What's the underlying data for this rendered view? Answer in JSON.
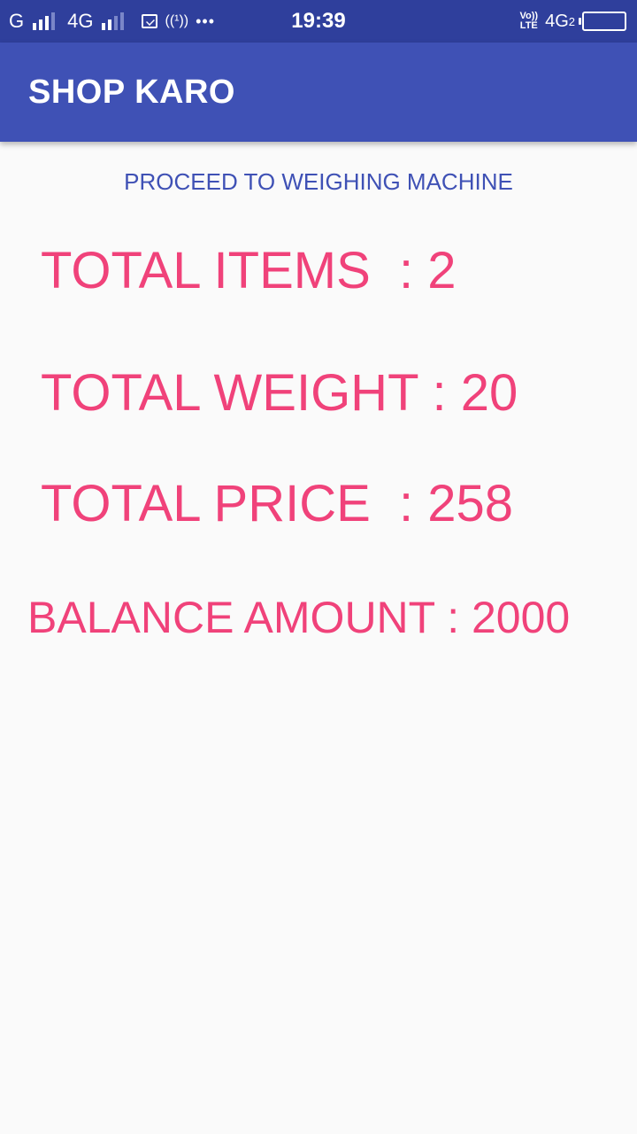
{
  "status_bar": {
    "carrier1_type": "G",
    "carrier2_type": "4G",
    "time": "19:39",
    "network_right": "4G",
    "volte_top": "Vo))",
    "volte_bottom": "LTE",
    "sim_number": "2",
    "hotspot_glyph": "((¹))",
    "more_glyph": "•••",
    "icons": [
      "signal-icon",
      "signal-icon",
      "mail-icon",
      "hotspot-icon",
      "more-icon",
      "battery-icon"
    ]
  },
  "app_bar": {
    "title": "SHOP KARO",
    "color": "#3f51b5",
    "status_color": "#2f3f9c"
  },
  "content": {
    "subtitle": "PROCEED TO WEIGHING MACHINE",
    "total_items": "TOTAL ITEMS  : 2",
    "total_weight": "TOTAL WEIGHT : 20",
    "total_price": "TOTAL PRICE  : 258",
    "balance_amount": "BALANCE AMOUNT : 2000",
    "accent_color": "#f0427a"
  }
}
